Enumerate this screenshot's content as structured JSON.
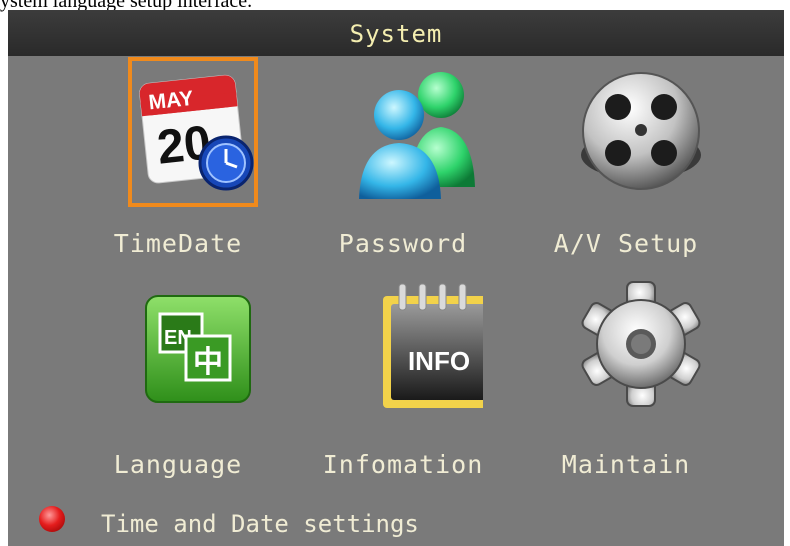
{
  "caption": "ystem language setup interface.",
  "window": {
    "title": "System"
  },
  "menu": {
    "items": [
      {
        "label": "TimeDate",
        "icon": "calendar-clock-icon",
        "selected": true
      },
      {
        "label": "Password",
        "icon": "users-icon",
        "selected": false
      },
      {
        "label": "A/V Setup",
        "icon": "film-reel-icon",
        "selected": false
      },
      {
        "label": "Language",
        "icon": "language-en-zh-icon",
        "selected": false
      },
      {
        "label": "Infomation",
        "icon": "info-notebook-icon",
        "selected": false
      },
      {
        "label": "Maintain",
        "icon": "gear-icon",
        "selected": false
      }
    ]
  },
  "icon_text": {
    "month": "MAY",
    "day": "20",
    "lang_en": "EN",
    "lang_zh": "中",
    "info": "INFO"
  },
  "status": {
    "text": "Time and Date settings",
    "indicator_color": "#e51d1d"
  },
  "colors": {
    "selection": "#f08a1c",
    "label": "#f0ecd4",
    "title": "#f4eeb0"
  }
}
